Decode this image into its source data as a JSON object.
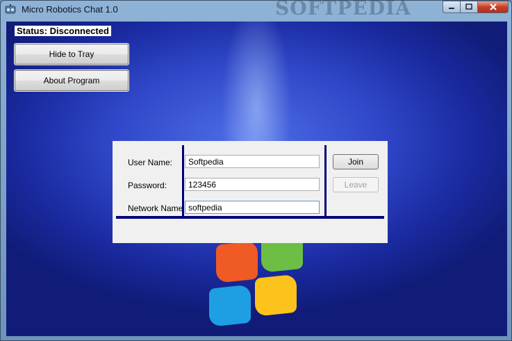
{
  "window": {
    "title": "Micro Robotics Chat 1.0",
    "watermark": "SOFTPEDIA"
  },
  "status": {
    "text": "Status: Disconnected"
  },
  "buttons": {
    "hide_to_tray": "Hide to Tray",
    "about_program": "About Program"
  },
  "login": {
    "user_name_label": "User Name:",
    "password_label": "Password:",
    "network_name_label": "Network Name",
    "user_name_value": "Softpedia",
    "password_value": "123456",
    "network_name_value": "softpedia",
    "join_label": "Join",
    "leave_label": "Leave"
  },
  "colors": {
    "accent_bar": "#00007a",
    "background": "#1f34b0"
  }
}
